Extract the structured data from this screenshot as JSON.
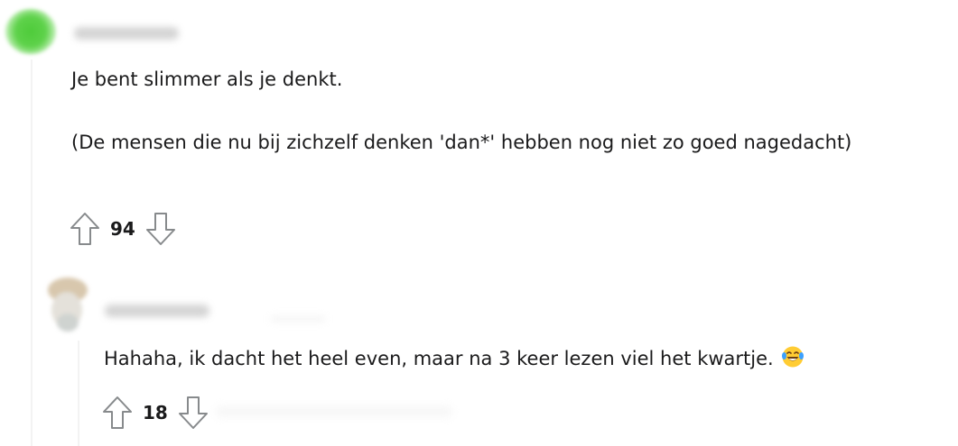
{
  "comment": {
    "username": "",
    "paragraphs": [
      "Je bent slimmer als je denkt.",
      "(De mensen die nu bij zichzelf denken 'dan*' hebben nog niet zo goed nagedacht)"
    ],
    "score": "94",
    "icons": {
      "upvote": "upvote-arrow-icon",
      "downvote": "downvote-arrow-icon",
      "avatar": "green-avatar"
    },
    "avatar_color": "#4ecb3a"
  },
  "reply": {
    "username": "",
    "text": "Hahaha, ik dacht het heel even, maar na 3 keer lezen viel het kwartje.",
    "emoji": "😂",
    "score": "18",
    "icons": {
      "upvote": "upvote-arrow-icon",
      "downvote": "downvote-arrow-icon",
      "emoji": "face-with-tears-of-joy-icon"
    }
  }
}
